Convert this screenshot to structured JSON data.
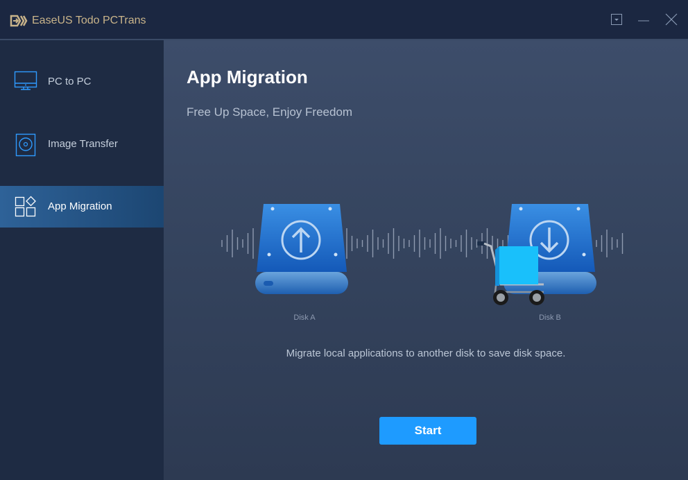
{
  "app": {
    "title": "EaseUS Todo PCTrans"
  },
  "sidebar": {
    "items": [
      {
        "label": "PC to PC",
        "icon": "monitor-icon"
      },
      {
        "label": "Image Transfer",
        "icon": "disc-image-icon"
      },
      {
        "label": "App Migration",
        "icon": "apps-grid-icon",
        "active": true
      }
    ]
  },
  "main": {
    "title": "App Migration",
    "subtitle": "Free Up Space, Enjoy Freedom",
    "disk_a": "Disk A",
    "disk_b": "Disk B",
    "description": "Migrate local applications to another disk to save disk space.",
    "start_label": "Start"
  },
  "colors": {
    "accent": "#1e9bff",
    "brand": "#c9b48a",
    "disk": "#1f6fd0"
  }
}
